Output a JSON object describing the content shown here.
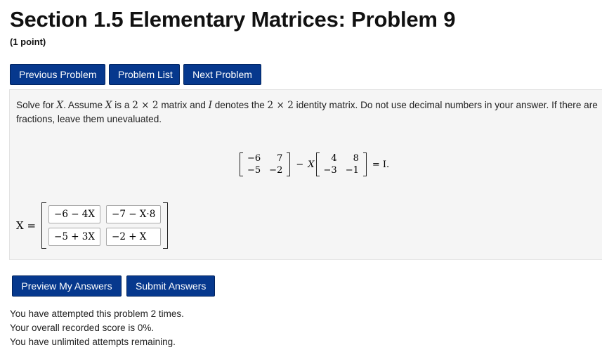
{
  "header": {
    "title": "Section 1.5 Elementary Matrices: Problem 9",
    "points": "(1 point)"
  },
  "nav": {
    "previous": "Previous Problem",
    "list": "Problem List",
    "next": "Next Problem"
  },
  "problem": {
    "prompt_1": "Solve for ",
    "var_x": "X",
    "prompt_2": ". Assume ",
    "prompt_3": " is a ",
    "two_by_two": "2 × 2",
    "prompt_4": " matrix and ",
    "var_i": "I",
    "prompt_5": " denotes the ",
    "prompt_6": " identity matrix. Do not use decimal numbers in your answer. If there are fractions, leave them unevaluated.",
    "matrix_a": [
      [
        "−6",
        "7"
      ],
      [
        "−5",
        "−2"
      ]
    ],
    "minus": "−",
    "matrix_b": [
      [
        "4",
        "8"
      ],
      [
        "−3",
        "−1"
      ]
    ],
    "equals_i": "= I."
  },
  "answer": {
    "label": "X =",
    "cells": [
      "−6 − 4X",
      "−7 − X·8",
      "−5 + 3X",
      "−2 + X"
    ]
  },
  "actions": {
    "preview": "Preview My Answers",
    "submit": "Submit Answers"
  },
  "status": {
    "attempts": "You have attempted this problem 2 times.",
    "score": "Your overall recorded score is 0%.",
    "remaining": "You have unlimited attempts remaining."
  }
}
